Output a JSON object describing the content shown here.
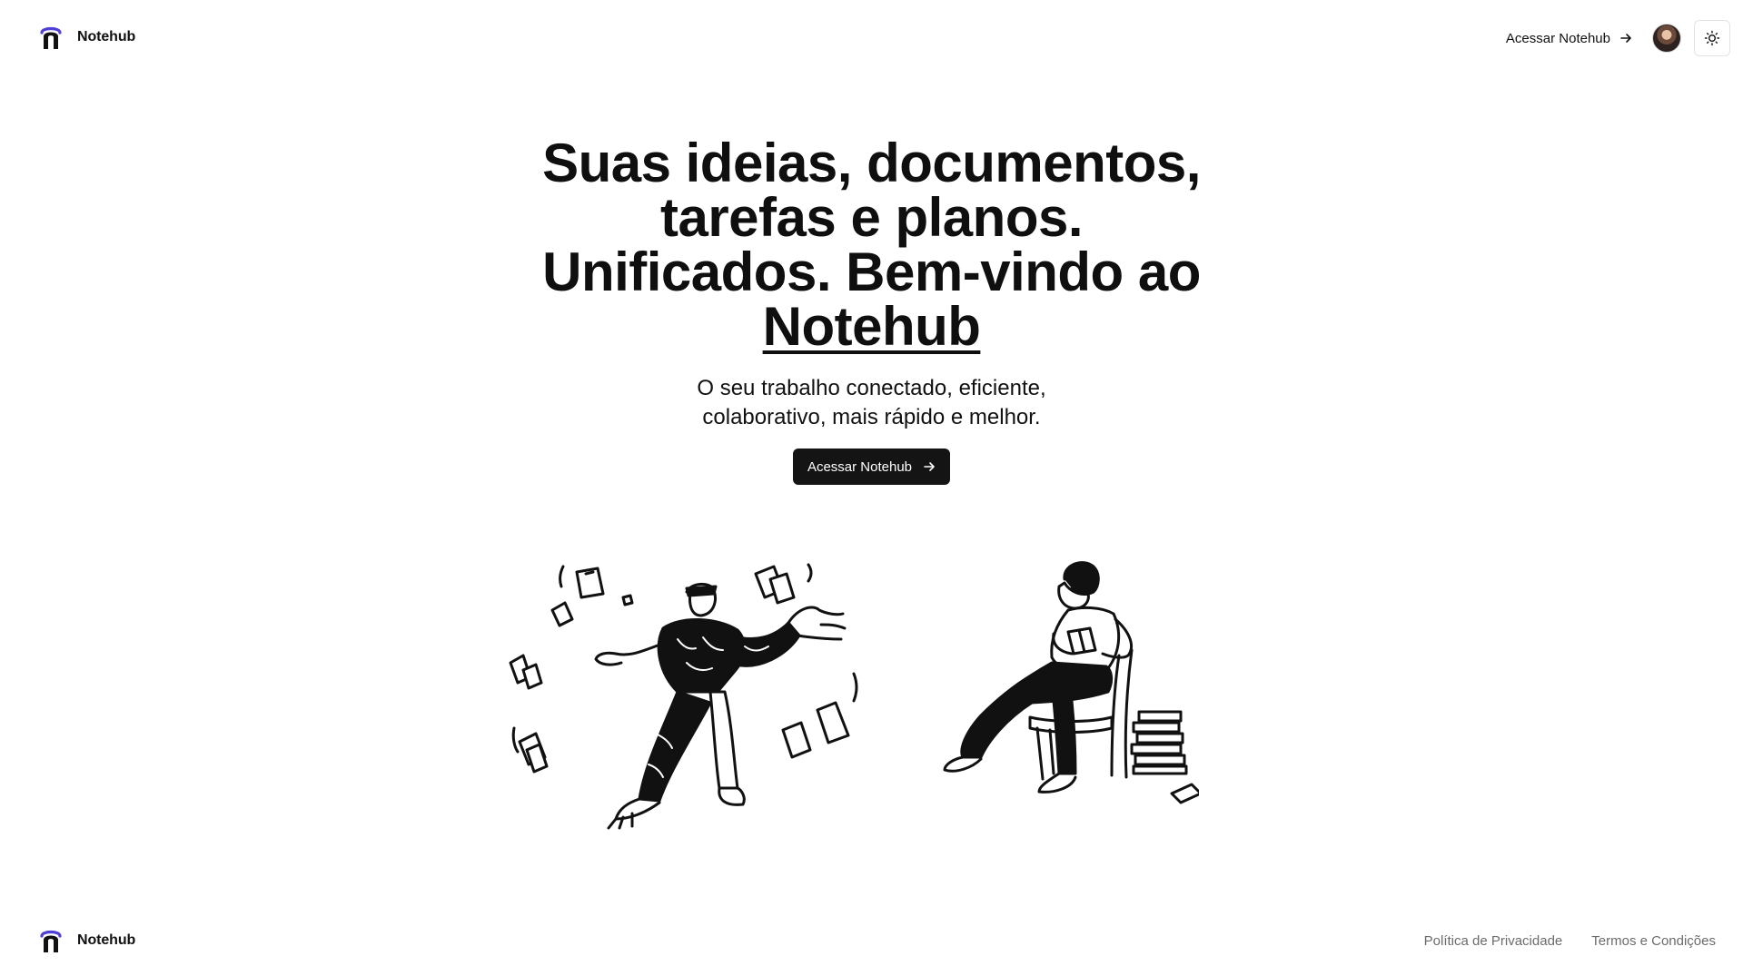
{
  "header": {
    "brand_name": "Notehub",
    "access_link": "Acessar Notehub",
    "icons": {
      "logo": "notehub-logo-icon",
      "arrow": "arrow-right-icon",
      "theme": "sun-icon"
    }
  },
  "hero": {
    "title_line_1": "Suas ideias, documentos,",
    "title_line_2": "tarefas e planos.",
    "title_line_3": "Unificados. Bem-vindo ao",
    "title_brand": "Notehub",
    "subtitle": "O seu trabalho conectado, eficiente, colaborativo, mais rápido e melhor.",
    "cta_label": "Acessar Notehub"
  },
  "footer": {
    "brand_name": "Notehub",
    "links": [
      "Política de Privacidade",
      "Termos e Condições"
    ]
  },
  "colors": {
    "logo_accent": "#4f3fd6",
    "logo_dark": "#111111",
    "cta_background": "#141414",
    "footer_link": "#6b6b6b"
  }
}
